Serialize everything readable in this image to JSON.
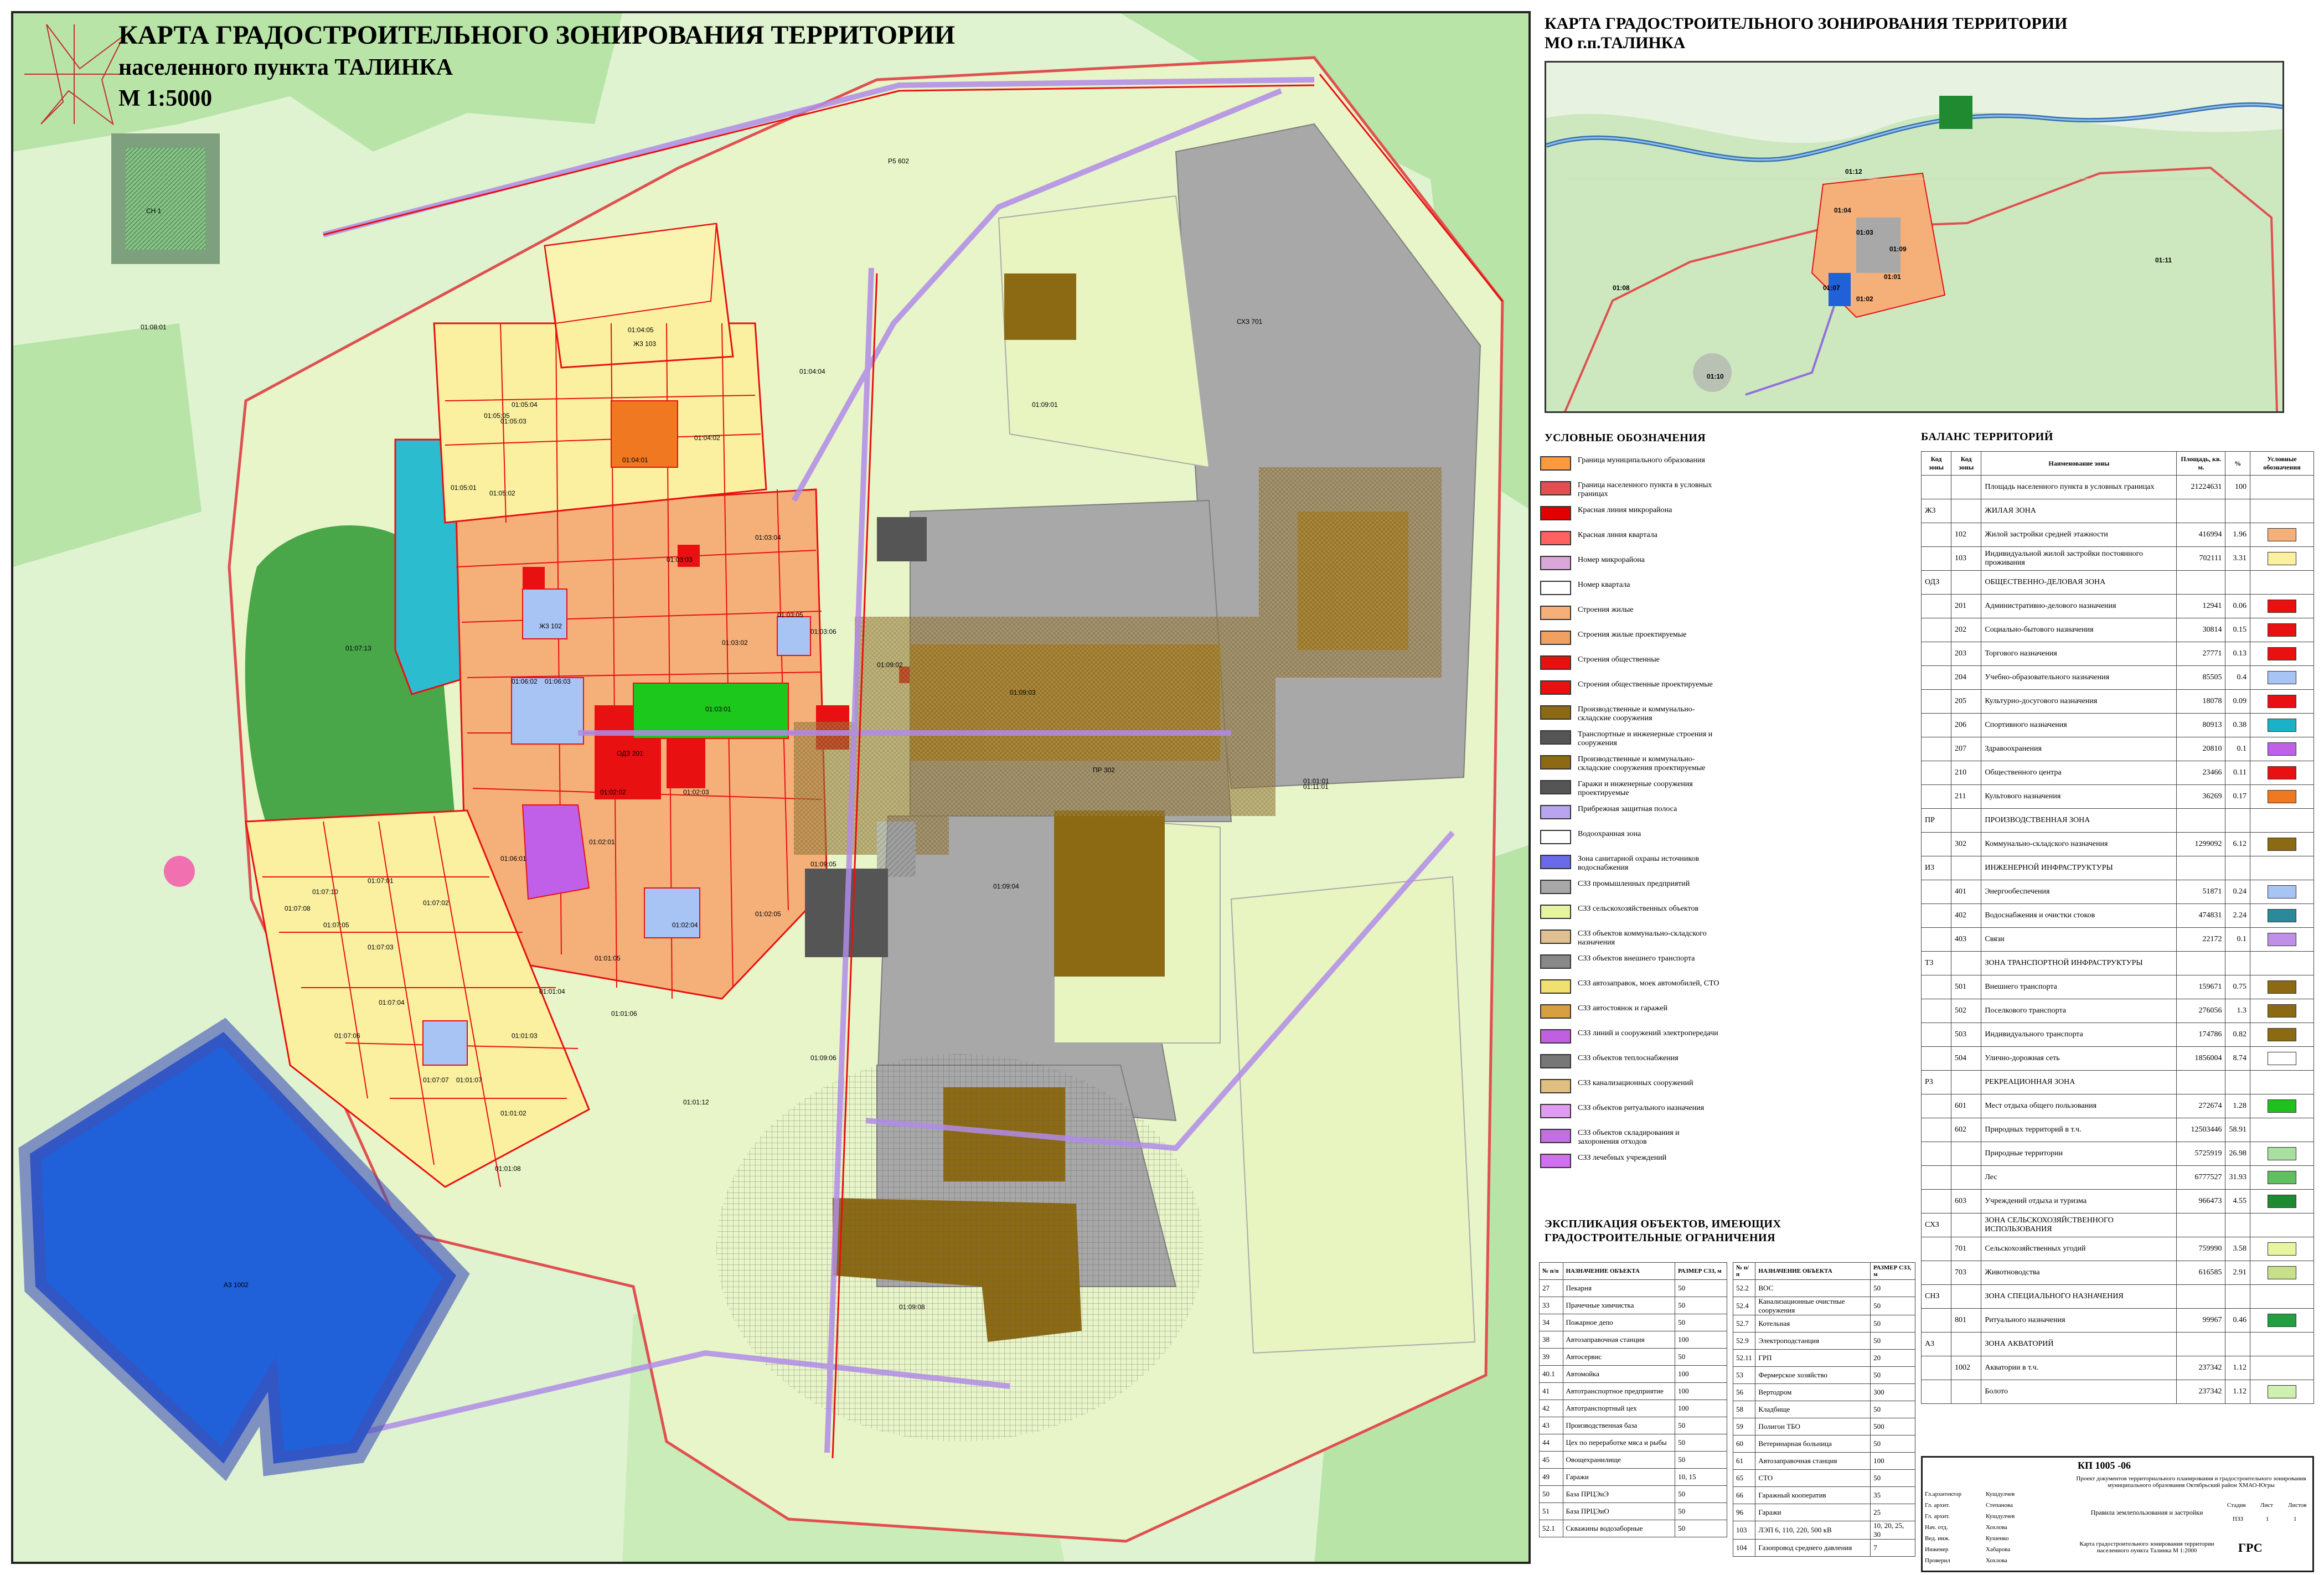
{
  "title": {
    "line1": "КАРТА ГРАДОСТРОИТЕЛЬНОГО ЗОНИРОВАНИЯ ТЕРРИТОРИИ",
    "line2": "населенного пункта ТАЛИНКА",
    "scale": "М 1:5000"
  },
  "overview": {
    "title1": "КАРТА ГРАДОСТРОИТЕЛЬНОГО ЗОНИРОВАНИЯ ТЕРРИТОРИИ",
    "title2": "МО г.п.ТАЛИНКА",
    "labels": [
      "01:12",
      "01:04",
      "01:11",
      "01:09",
      "01:08",
      "01:10",
      "01:07",
      "01:03",
      "01:01",
      "01:02"
    ]
  },
  "map_labels": {
    "quarters": [
      "01:08:01",
      "01:04:04",
      "01:04:05",
      "01:04:01",
      "01:04:02",
      "01:05:01",
      "01:05:02",
      "01:05:03",
      "01:05:04",
      "01:05:05",
      "01:03:01",
      "01:03:02",
      "01:03:03",
      "01:03:04",
      "01:03:05",
      "01:03:06",
      "01:02:01",
      "01:02:02",
      "01:02:03",
      "01:02:04",
      "01:02:05",
      "01:06:01",
      "01:06:02",
      "01:06:03",
      "01:07:01",
      "01:07:02",
      "01:07:03",
      "01:07:04",
      "01:07:05",
      "01:07:06",
      "01:07:07",
      "01:07:08",
      "01:07:10",
      "01:07:13",
      "01:01:01",
      "01:01:02",
      "01:01:03",
      "01:01:04",
      "01:01:05",
      "01:01:06",
      "01:01:07",
      "01:01:08",
      "01:01:12",
      "01:09:01",
      "01:09:02",
      "01:09:03",
      "01:09:04",
      "01:09:05",
      "01:09:06",
      "01:09:08",
      "01:11:01"
    ],
    "zones": [
      "Р5 602",
      "Ж3 103",
      "Ж3 102",
      "ОДЗ 201",
      "ПР 302",
      "СХЗ 701",
      "СН 1",
      "А3 1002"
    ]
  },
  "legend": {
    "title": "УСЛОВНЫЕ ОБОЗНАЧЕНИЯ",
    "items": [
      {
        "label": "Граница муниципального образования",
        "color": "#ff9a3c"
      },
      {
        "label": "Граница населенного пункта в условных границах",
        "color": "#e05050"
      },
      {
        "label": "Красная линия микрорайона",
        "color": "#e00000"
      },
      {
        "label": "Красная линия квартала",
        "color": "#ff6060"
      },
      {
        "label": "Номер микрорайона",
        "color": "#d9a7d9"
      },
      {
        "label": "Номер квартала",
        "color": "#ffffff"
      },
      {
        "label": "Строения жилые",
        "color": "#f5b07a"
      },
      {
        "label": "Строения жилые проектируемые",
        "color": "#f0a060"
      },
      {
        "label": "Строения общественные",
        "color": "#e81010"
      },
      {
        "label": "Строения общественные проектируемые",
        "color": "#e81010"
      },
      {
        "label": "Производственные и коммунально-складские сооружения",
        "color": "#8c6a14"
      },
      {
        "label": "Транспортные и инженерные строения и сооружения",
        "color": "#555555"
      },
      {
        "label": "Производственные и коммунально-складские сооружения проектируемые",
        "color": "#8c6a14"
      },
      {
        "label": "Гаражи и инженерные сооружения проектируемые",
        "color": "#555555"
      },
      {
        "label": "Прибрежная защитная полоса",
        "color": "#b9a4f0"
      },
      {
        "label": "Водоохранная зона",
        "color": "#ffffff"
      },
      {
        "label": "Зона санитарной охраны источников водоснабжения",
        "color": "#6a6ae8"
      },
      {
        "label": "СЗЗ промышленных предприятий",
        "color": "#a8a8a8"
      },
      {
        "label": "СЗЗ сельскохозяйственных объектов",
        "color": "#e8f5a0"
      },
      {
        "label": "СЗЗ объектов коммунально-складского назначения",
        "color": "#e0c090"
      },
      {
        "label": "СЗЗ объектов внешнего транспорта",
        "color": "#888888"
      },
      {
        "label": "СЗЗ автозаправок, моек автомобилей, СТО",
        "color": "#f0e070"
      },
      {
        "label": "СЗЗ автостоянок и гаражей",
        "color": "#d6a040"
      },
      {
        "label": "СЗЗ линий и сооружений электропередачи",
        "color": "#c060e0"
      },
      {
        "label": "СЗЗ объектов теплоснабжения",
        "color": "#777777"
      },
      {
        "label": "СЗЗ канализационных сооружений",
        "color": "#e0c080"
      },
      {
        "label": "СЗЗ объектов ритуального назначения",
        "color": "#e09cf0"
      },
      {
        "label": "СЗЗ объектов складирования и захоронения отходов",
        "color": "#c070e0"
      },
      {
        "label": "СЗЗ лечебных учреждений",
        "color": "#d070f0"
      }
    ]
  },
  "balance": {
    "title": "БАЛАНС ТЕРРИТОРИЙ",
    "headers": [
      "Код зоны",
      "Код зоны",
      "Наименование зоны",
      "Площадь, кв. м.",
      "%",
      "Условные обозначения"
    ],
    "rows": [
      {
        "c1": "",
        "c2": "",
        "name": "Площадь населенного пункта в условных границах",
        "area": "21224631",
        "pct": "100",
        "color": ""
      },
      {
        "c1": "Ж3",
        "c2": "",
        "name": "ЖИЛАЯ ЗОНА",
        "area": "",
        "pct": "",
        "color": ""
      },
      {
        "c1": "",
        "c2": "102",
        "name": "Жилой застройки средней этажности",
        "area": "416994",
        "pct": "1.96",
        "color": "#f5b07a"
      },
      {
        "c1": "",
        "c2": "103",
        "name": "Индивидуальной жилой застройки постоянного проживания",
        "area": "702111",
        "pct": "3.31",
        "color": "#faf0a0"
      },
      {
        "c1": "ОДЗ",
        "c2": "",
        "name": "ОБЩЕСТВЕННО-ДЕЛОВАЯ ЗОНА",
        "area": "",
        "pct": "",
        "color": ""
      },
      {
        "c1": "",
        "c2": "201",
        "name": "Административно-делового назначения",
        "area": "12941",
        "pct": "0.06",
        "color": "#e81010"
      },
      {
        "c1": "",
        "c2": "202",
        "name": "Социально-бытового назначения",
        "area": "30814",
        "pct": "0.15",
        "color": "#e81010"
      },
      {
        "c1": "",
        "c2": "203",
        "name": "Торгового назначения",
        "area": "27771",
        "pct": "0.13",
        "color": "#e81010"
      },
      {
        "c1": "",
        "c2": "204",
        "name": "Учебно-образовательного назначения",
        "area": "85505",
        "pct": "0.4",
        "color": "#a8c4f5"
      },
      {
        "c1": "",
        "c2": "205",
        "name": "Культурно-досугового назначения",
        "area": "18078",
        "pct": "0.09",
        "color": "#e81010"
      },
      {
        "c1": "",
        "c2": "206",
        "name": "Спортивного назначения",
        "area": "80913",
        "pct": "0.38",
        "color": "#1ab2c8"
      },
      {
        "c1": "",
        "c2": "207",
        "name": "Здравоохранения",
        "area": "20810",
        "pct": "0.1",
        "color": "#c060e8"
      },
      {
        "c1": "",
        "c2": "210",
        "name": "Общественного центра",
        "area": "23466",
        "pct": "0.11",
        "color": "#e81010"
      },
      {
        "c1": "",
        "c2": "211",
        "name": "Культового назначения",
        "area": "36269",
        "pct": "0.17",
        "color": "#f07820"
      },
      {
        "c1": "ПР",
        "c2": "",
        "name": "ПРОИЗВОДСТВЕННАЯ ЗОНА",
        "area": "",
        "pct": "",
        "color": ""
      },
      {
        "c1": "",
        "c2": "302",
        "name": "Коммунально-складского назначения",
        "area": "1299092",
        "pct": "6.12",
        "color": "#8c6a14"
      },
      {
        "c1": "И3",
        "c2": "",
        "name": "ИНЖЕНЕРНОЙ ИНФРАСТРУКТУРЫ",
        "area": "",
        "pct": "",
        "color": ""
      },
      {
        "c1": "",
        "c2": "401",
        "name": "Энергообеспечения",
        "area": "51871",
        "pct": "0.24",
        "color": "#a8c4f5"
      },
      {
        "c1": "",
        "c2": "402",
        "name": "Водоснабжения и очистки стоков",
        "area": "474831",
        "pct": "2.24",
        "color": "#2a8a9a"
      },
      {
        "c1": "",
        "c2": "403",
        "name": "Связи",
        "area": "22172",
        "pct": "0.1",
        "color": "#c090e8"
      },
      {
        "c1": "Т3",
        "c2": "",
        "name": "ЗОНА ТРАНСПОРТНОЙ ИНФРАСТРУКТУРЫ",
        "area": "",
        "pct": "",
        "color": ""
      },
      {
        "c1": "",
        "c2": "501",
        "name": "Внешнего транспорта",
        "area": "159671",
        "pct": "0.75",
        "color": "#8c6a14"
      },
      {
        "c1": "",
        "c2": "502",
        "name": "Поселкового транспорта",
        "area": "276056",
        "pct": "1.3",
        "color": "#8c6a14"
      },
      {
        "c1": "",
        "c2": "503",
        "name": "Индивидуального транспорта",
        "area": "174786",
        "pct": "0.82",
        "color": "#8c6a14"
      },
      {
        "c1": "",
        "c2": "504",
        "name": "Улично-дорожная сеть",
        "area": "1856004",
        "pct": "8.74",
        "color": "#ffffff"
      },
      {
        "c1": "Р3",
        "c2": "",
        "name": "РЕКРЕАЦИОННАЯ ЗОНА",
        "area": "",
        "pct": "",
        "color": ""
      },
      {
        "c1": "",
        "c2": "601",
        "name": "Мест отдыха общего пользования",
        "area": "272674",
        "pct": "1.28",
        "color": "#20c020"
      },
      {
        "c1": "",
        "c2": "602",
        "name": "Природных территорий в т.ч.",
        "area": "12503446",
        "pct": "58.91",
        "color": ""
      },
      {
        "c1": "",
        "c2": "",
        "name": "Природные территории",
        "area": "5725919",
        "pct": "26.98",
        "color": "#a8e0a0"
      },
      {
        "c1": "",
        "c2": "",
        "name": "Лес",
        "area": "6777527",
        "pct": "31.93",
        "color": "#60c060"
      },
      {
        "c1": "",
        "c2": "603",
        "name": "Учреждений отдыха и туризма",
        "area": "966473",
        "pct": "4.55",
        "color": "#208a30"
      },
      {
        "c1": "СХЗ",
        "c2": "",
        "name": "ЗОНА СЕЛЬСКОХОЗЯЙСТВЕННОГО ИСПОЛЬЗОВАНИЯ",
        "area": "",
        "pct": "",
        "color": ""
      },
      {
        "c1": "",
        "c2": "701",
        "name": "Сельскохозяйственных угодий",
        "area": "759990",
        "pct": "3.58",
        "color": "#e8f5a0"
      },
      {
        "c1": "",
        "c2": "703",
        "name": "Животноводства",
        "area": "616585",
        "pct": "2.91",
        "color": "#c8e08a"
      },
      {
        "c1": "СНЗ",
        "c2": "",
        "name": "ЗОНА СПЕЦИАЛЬНОГО НАЗНАЧЕНИЯ",
        "area": "",
        "pct": "",
        "color": ""
      },
      {
        "c1": "",
        "c2": "801",
        "name": "Ритуального назначения",
        "area": "99967",
        "pct": "0.46",
        "color": "#20a040"
      },
      {
        "c1": "А3",
        "c2": "",
        "name": "ЗОНА АКВАТОРИЙ",
        "area": "",
        "pct": "",
        "color": ""
      },
      {
        "c1": "",
        "c2": "1002",
        "name": "Акватории в т.ч.",
        "area": "237342",
        "pct": "1.12",
        "color": ""
      },
      {
        "c1": "",
        "c2": "",
        "name": "Болото",
        "area": "237342",
        "pct": "1.12",
        "color": "#d0f0b0"
      }
    ]
  },
  "explication": {
    "title1": "ЭКСПЛИКАЦИЯ ОБЪЕКТОВ, ИМЕЮЩИХ",
    "title2": "ГРАДОСТРОИТЕЛЬНЫЕ ОГРАНИЧЕНИЯ",
    "headers": [
      "№ п/п",
      "НАЗНАЧЕНИЕ ОБЪЕКТА",
      "РАЗМЕР СЗЗ, м"
    ],
    "left": [
      [
        "27",
        "Пекарня",
        "50"
      ],
      [
        "33",
        "Прачечные химчистка",
        "50"
      ],
      [
        "34",
        "Пожарное депо",
        "50"
      ],
      [
        "38",
        "Автозаправочная станция",
        "100"
      ],
      [
        "39",
        "Автосервис",
        "50"
      ],
      [
        "40.1",
        "Автомойка",
        "100"
      ],
      [
        "41",
        "Автотранспортное предприятие",
        "100"
      ],
      [
        "42",
        "Автотранспортный цех",
        "100"
      ],
      [
        "43",
        "Производственная база",
        "50"
      ],
      [
        "44",
        "Цех по переработке мяса и рыбы",
        "50"
      ],
      [
        "45",
        "Овощехранилище",
        "50"
      ],
      [
        "49",
        "Гаражи",
        "10, 15"
      ],
      [
        "50",
        "База ПРЦЭиЭ",
        "50"
      ],
      [
        "51",
        "База ПРЦЭиО",
        "50"
      ],
      [
        "52.1",
        "Скважины водозаборные",
        "50"
      ]
    ],
    "right": [
      [
        "52.2",
        "ВОС",
        "50"
      ],
      [
        "52.4",
        "Канализационные очистные сооружения",
        "50"
      ],
      [
        "52.7",
        "Котельная",
        "50"
      ],
      [
        "52.9",
        "Электроподстанция",
        "50"
      ],
      [
        "52.11",
        "ГРП",
        "20"
      ],
      [
        "53",
        "Фермерское хозяйство",
        "50"
      ],
      [
        "56",
        "Вертодром",
        "300"
      ],
      [
        "58",
        "Кладбище",
        "50"
      ],
      [
        "59",
        "Полигон ТБО",
        "500"
      ],
      [
        "60",
        "Ветеринарная больница",
        "50"
      ],
      [
        "61",
        "Автозаправочная станция",
        "100"
      ],
      [
        "65",
        "СТО",
        "50"
      ],
      [
        "66",
        "Гаражный кооператив",
        "35"
      ],
      [
        "96",
        "Гаражи",
        "25"
      ],
      [
        "103",
        "ЛЭП 6, 110, 220, 500 кВ",
        "10, 20, 25, 30"
      ],
      [
        "104",
        "Газопровод среднего давления",
        "7"
      ]
    ]
  },
  "stamp": {
    "code": "КП 1005 -06",
    "project": "Проект документов территориального планирования и градостроительного зонирования муниципального образования Октябрьский район ХМАО-Югры",
    "doc": "Правила землепользования и застройки",
    "sheet_title": "Карта градостроительного зонирования территории населенного пункта Талинка М 1:2000",
    "stage_h": "Стадия",
    "sheet_h": "Лист",
    "sheets_h": "Листов",
    "stage": "ПЗЗ",
    "sheet": "1",
    "sheets": "1",
    "org": "ГРС",
    "roles": [
      "Гл.архитектор",
      "Гл. архит.",
      "Гл. архит.",
      "Нач. отд.",
      "Вед. инж.",
      "Инженер",
      "Проверил"
    ],
    "names": [
      "Кушдулчев",
      "Степанова",
      "Кушдулчев",
      "Хохлова",
      "Кушенко",
      "Хабарова",
      "Хохлова"
    ]
  }
}
